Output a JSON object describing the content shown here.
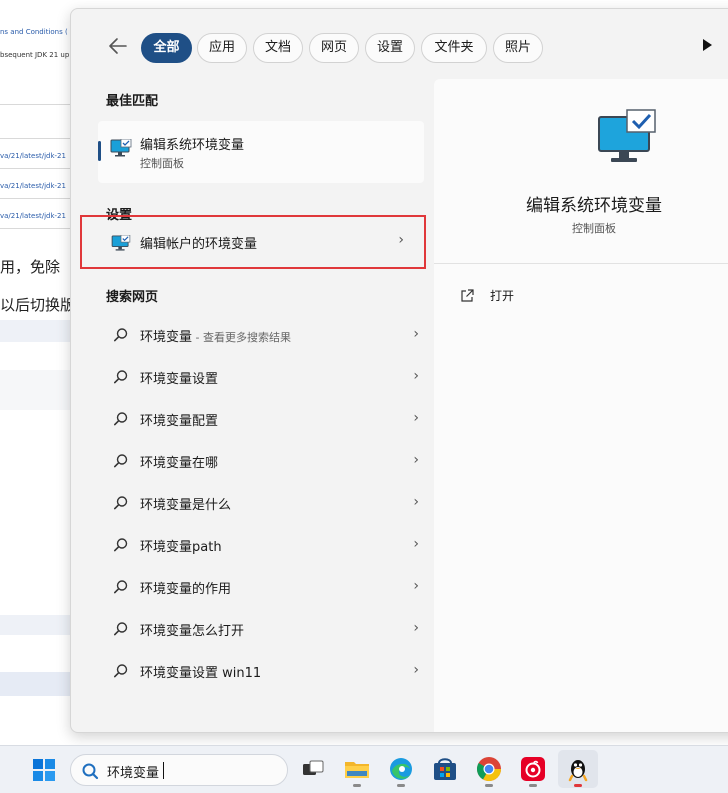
{
  "background_window": {
    "lines": [
      "ns and Conditions (",
      "bsequent JDK 21 up",
      "va/21/latest/jdk-21",
      "va/21/latest/jdk-21",
      "va/21/latest/jdk-21"
    ],
    "text1": "用，免除",
    "text2": "以后切换版"
  },
  "search_panel": {
    "tabs": [
      "全部",
      "应用",
      "文档",
      "网页",
      "设置",
      "文件夹",
      "照片"
    ],
    "best_match": {
      "heading": "最佳匹配",
      "title": "编辑系统环境变量",
      "subtitle": "控制面板"
    },
    "settings": {
      "heading": "设置",
      "item": "编辑帐户的环境变量"
    },
    "web": {
      "heading": "搜索网页",
      "results": [
        {
          "text": "环境变量",
          "suffix": " - 查看更多搜索结果"
        },
        {
          "text": "环境变量设置",
          "suffix": ""
        },
        {
          "text": "环境变量配置",
          "suffix": ""
        },
        {
          "text": "环境变量在哪",
          "suffix": ""
        },
        {
          "text": "环境变量是什么",
          "suffix": ""
        },
        {
          "text": "环境变量path",
          "suffix": ""
        },
        {
          "text": "环境变量的作用",
          "suffix": ""
        },
        {
          "text": "环境变量怎么打开",
          "suffix": ""
        },
        {
          "text": "环境变量设置 win11",
          "suffix": ""
        }
      ]
    },
    "preview": {
      "title": "编辑系统环境变量",
      "subtitle": "控制面板",
      "action": "打开"
    }
  },
  "taskbar": {
    "search_value": "环境变量",
    "apps": [
      "task-view",
      "file-explorer",
      "edge",
      "microsoft-store",
      "chrome",
      "netease-music",
      "qq"
    ]
  },
  "colors": {
    "accent": "#1f4f86",
    "highlight_box": "#e0373a"
  }
}
